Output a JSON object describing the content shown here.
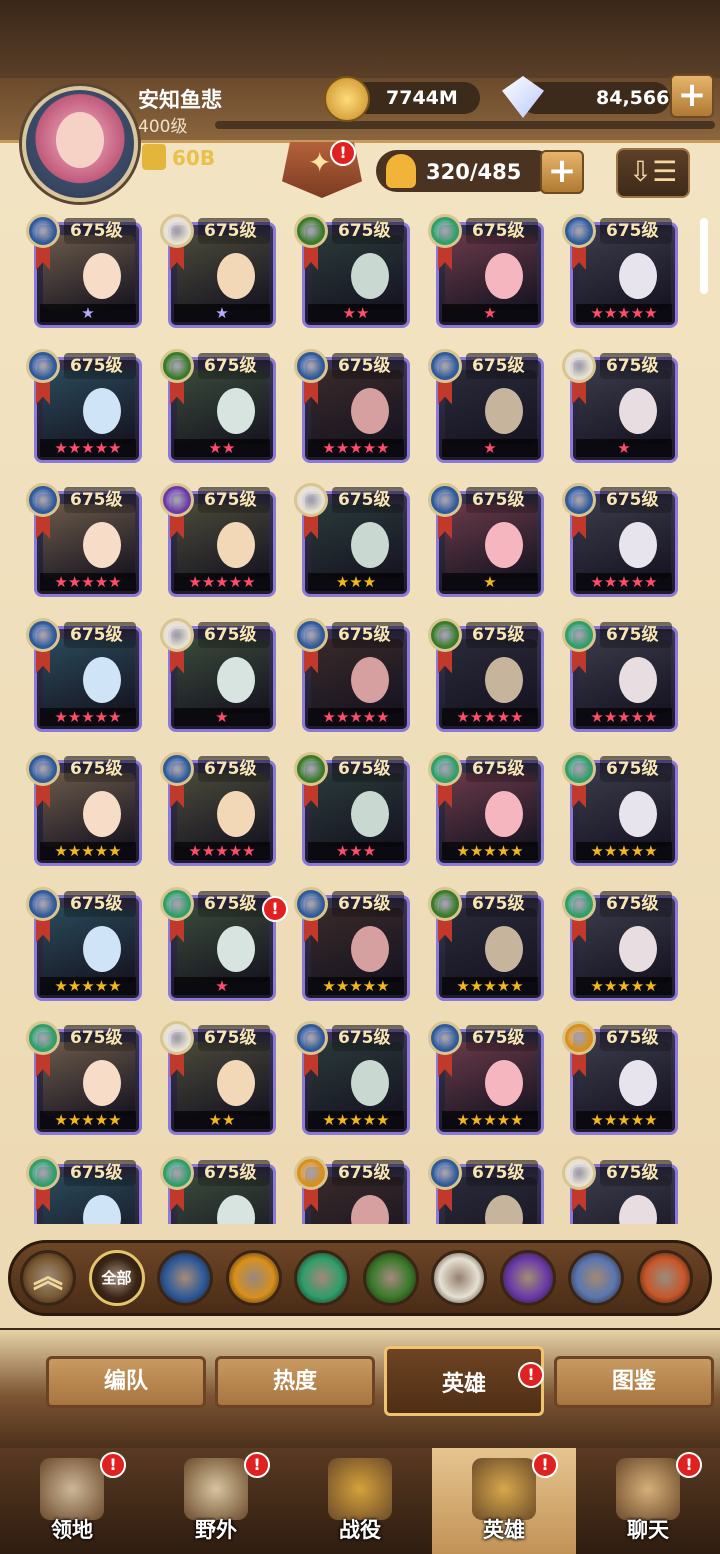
{
  "player": {
    "name": "安知鱼悲",
    "level": "400级",
    "power": "60B"
  },
  "currency": {
    "gold": "7744M",
    "gems": "84,566"
  },
  "hero_count": "320/485",
  "alerts": {
    "mark": "!"
  },
  "heroes": [
    {
      "level": "675级",
      "stars": "★",
      "star_color": "#b9a8ff",
      "faction": "lightbearer"
    },
    {
      "level": "675级",
      "stars": "★",
      "star_color": "#b9a8ff",
      "faction": "celestial"
    },
    {
      "level": "675级",
      "stars": "★★",
      "star_color": "#ff4d6a",
      "faction": "graveborn"
    },
    {
      "level": "675级",
      "stars": "★",
      "star_color": "#ff4d6a",
      "faction": "wilder"
    },
    {
      "level": "675级",
      "stars": "★★★★★",
      "star_color": "#ff4d6a",
      "faction": "lightbearer"
    },
    {
      "level": "675级",
      "stars": "★★★★★",
      "star_color": "#ff4d6a",
      "faction": "lightbearer"
    },
    {
      "level": "675级",
      "stars": "★★",
      "star_color": "#ff4d6a",
      "faction": "graveborn"
    },
    {
      "level": "675级",
      "stars": "★★★★★",
      "star_color": "#ff4d6a",
      "faction": "lightbearer"
    },
    {
      "level": "675级",
      "stars": "★",
      "star_color": "#ff4d6a",
      "faction": "lightbearer"
    },
    {
      "level": "675级",
      "stars": "★",
      "star_color": "#ff4d6a",
      "faction": "celestial"
    },
    {
      "level": "675级",
      "stars": "★★★★★",
      "star_color": "#ff4d6a",
      "faction": "lightbearer"
    },
    {
      "level": "675级",
      "stars": "★★★★★",
      "star_color": "#ff4d6a",
      "faction": "hypogean"
    },
    {
      "level": "675级",
      "stars": "★★★",
      "star_color": "#f4b81c",
      "faction": "celestial"
    },
    {
      "level": "675级",
      "stars": "★",
      "star_color": "#f4b81c",
      "faction": "lightbearer"
    },
    {
      "level": "675级",
      "stars": "★★★★★",
      "star_color": "#ff4d6a",
      "faction": "lightbearer"
    },
    {
      "level": "675级",
      "stars": "★★★★★",
      "star_color": "#ff4d6a",
      "faction": "lightbearer"
    },
    {
      "level": "675级",
      "stars": "★",
      "star_color": "#ff4d6a",
      "faction": "celestial"
    },
    {
      "level": "675级",
      "stars": "★★★★★",
      "star_color": "#ff4d6a",
      "faction": "lightbearer"
    },
    {
      "level": "675级",
      "stars": "★★★★★",
      "star_color": "#ff4d6a",
      "faction": "graveborn"
    },
    {
      "level": "675级",
      "stars": "★★★★★",
      "star_color": "#ff4d6a",
      "faction": "wilder"
    },
    {
      "level": "675级",
      "stars": "★★★★★",
      "star_color": "#f4b81c",
      "faction": "lightbearer"
    },
    {
      "level": "675级",
      "stars": "★★★★★",
      "star_color": "#ff4d6a",
      "faction": "lightbearer"
    },
    {
      "level": "675级",
      "stars": "★★★",
      "star_color": "#ff4d6a",
      "faction": "graveborn"
    },
    {
      "level": "675级",
      "stars": "★★★★★",
      "star_color": "#f4b81c",
      "faction": "wilder"
    },
    {
      "level": "675级",
      "stars": "★★★★★",
      "star_color": "#f4b81c",
      "faction": "wilder"
    },
    {
      "level": "675级",
      "stars": "★★★★★",
      "star_color": "#f4b81c",
      "faction": "lightbearer"
    },
    {
      "level": "675级",
      "stars": "★",
      "star_color": "#ff4d6a",
      "faction": "wilder"
    },
    {
      "level": "675级",
      "stars": "★★★★★",
      "star_color": "#f4b81c",
      "faction": "lightbearer"
    },
    {
      "level": "675级",
      "stars": "★★★★★",
      "star_color": "#f4b81c",
      "faction": "graveborn"
    },
    {
      "level": "675级",
      "stars": "★★★★★",
      "star_color": "#f4b81c",
      "faction": "wilder"
    },
    {
      "level": "675级",
      "stars": "★★★★★",
      "star_color": "#f4b81c",
      "faction": "wilder"
    },
    {
      "level": "675级",
      "stars": "★★",
      "star_color": "#f4b81c",
      "faction": "celestial"
    },
    {
      "level": "675级",
      "stars": "★★★★★",
      "star_color": "#f4b81c",
      "faction": "lightbearer"
    },
    {
      "level": "675级",
      "stars": "★★★★★",
      "star_color": "#f4b81c",
      "faction": "lightbearer"
    },
    {
      "level": "675级",
      "stars": "★★★★★",
      "star_color": "#f4b81c",
      "faction": "mauler"
    },
    {
      "level": "675级",
      "stars": "",
      "star_color": "#f4b81c",
      "faction": "wilder"
    },
    {
      "level": "675级",
      "stars": "",
      "star_color": "#f4b81c",
      "faction": "wilder"
    },
    {
      "level": "675级",
      "stars": "",
      "star_color": "#f4b81c",
      "faction": "mauler"
    },
    {
      "level": "675级",
      "stars": "",
      "star_color": "#f4b81c",
      "faction": "lightbearer"
    },
    {
      "level": "675级",
      "stars": "",
      "star_color": "#f4b81c",
      "faction": "celestial"
    }
  ],
  "factions": [
    {
      "name": "collapse",
      "label": ""
    },
    {
      "name": "all",
      "label": "全部"
    },
    {
      "name": "lightbearer",
      "label": ""
    },
    {
      "name": "mauler",
      "label": ""
    },
    {
      "name": "wilder",
      "label": ""
    },
    {
      "name": "graveborn",
      "label": ""
    },
    {
      "name": "celestial",
      "label": ""
    },
    {
      "name": "hypogean",
      "label": ""
    },
    {
      "name": "dimensional",
      "label": ""
    },
    {
      "name": "dragon",
      "label": ""
    }
  ],
  "tabs": [
    "编队",
    "热度",
    "英雄",
    "图鉴"
  ],
  "nav": [
    "领地",
    "野外",
    "战役",
    "英雄",
    "聊天"
  ],
  "colors": {
    "lightbearer": "#2f5a9a",
    "mauler": "#d8901c",
    "wilder": "#2f9e6a",
    "graveborn": "#3a7a2a",
    "celestial": "#e6e1d2",
    "hypogean": "#6a3aa8",
    "dimensional": "#5a76b0",
    "dragon": "#c8572a",
    "all": "#3b2615",
    "collapse": "#7a5a34"
  }
}
